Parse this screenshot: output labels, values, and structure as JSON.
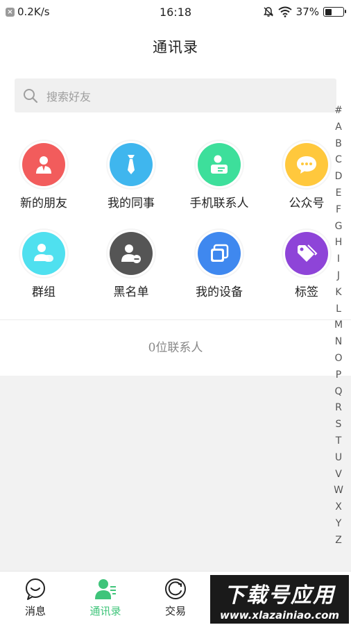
{
  "status_bar": {
    "net_speed": "0.2K/s",
    "time": "16:18",
    "battery": "37%",
    "battery_level": 0.37
  },
  "header": {
    "title": "通讯录"
  },
  "search": {
    "placeholder": "搜索好友"
  },
  "grid": [
    {
      "label": "新的朋友",
      "icon": "new-friend-icon",
      "color": "#f25c5c"
    },
    {
      "label": "我的同事",
      "icon": "tie-icon",
      "color": "#3fb6ee"
    },
    {
      "label": "手机联系人",
      "icon": "phone-contact-icon",
      "color": "#3ddf9b"
    },
    {
      "label": "公众号",
      "icon": "chat-bubble-icon",
      "color": "#ffc83d"
    },
    {
      "label": "群组",
      "icon": "group-icon",
      "color": "#4fe0ef"
    },
    {
      "label": "黑名单",
      "icon": "blacklist-icon",
      "color": "#555555"
    },
    {
      "label": "我的设备",
      "icon": "device-icon",
      "color": "#3f88ef"
    },
    {
      "label": "标签",
      "icon": "tag-icon",
      "color": "#8e44d8"
    }
  ],
  "contact_count": "0位联系人",
  "index_letters": [
    "#",
    "A",
    "B",
    "C",
    "D",
    "E",
    "F",
    "G",
    "H",
    "I",
    "J",
    "K",
    "L",
    "M",
    "N",
    "O",
    "P",
    "Q",
    "R",
    "S",
    "T",
    "U",
    "V",
    "W",
    "X",
    "Y",
    "Z"
  ],
  "tabs": [
    {
      "label": "消息",
      "icon": "message-icon",
      "active": false
    },
    {
      "label": "通讯录",
      "icon": "contacts-icon",
      "active": true
    },
    {
      "label": "交易",
      "icon": "trade-icon",
      "active": false
    }
  ],
  "watermark": {
    "title": "下载号应用",
    "url": "www.xlazainiao.com"
  },
  "colors": {
    "accent": "#3fc47a",
    "background": "#f2f2f2"
  }
}
